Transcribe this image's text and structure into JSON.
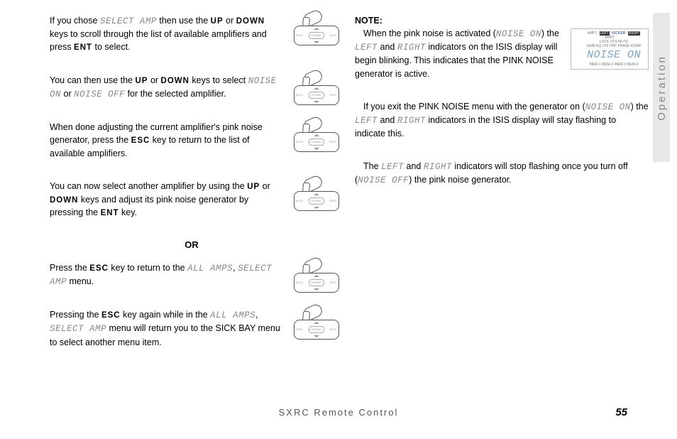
{
  "side_tab": "Operation",
  "footer": {
    "model": "SXRC Remote Control",
    "page": "55"
  },
  "keys": {
    "select_amp": "SELECT AMP",
    "up": "UP",
    "down": "DOWN",
    "ent": "ENT",
    "esc": "ESC",
    "noise_on": "NOISE ON",
    "noise_off": "NOISE OFF",
    "all_amps": "ALL AMPS",
    "left": "LEFT",
    "right": "RIGHT"
  },
  "left": {
    "p1a": "If you chose ",
    "p1b": " then use the ",
    "p1c": " or ",
    "p1d": " keys to scroll through the list of available amplifiers and press ",
    "p1e": " to select.",
    "p2a": "You can then use the ",
    "p2b": " or ",
    "p2c": " keys to select ",
    "p2d": " or ",
    "p2e": " for the selected amplifier.",
    "p3a": "When done adjusting the current amplifier's pink noise generator, press the ",
    "p3b": " key to return to the list of available amplifiers.",
    "p4a": "You can now select another amplifier by using the ",
    "p4b": " or ",
    "p4c": " keys and adjust its pink noise generator by pressing the ",
    "p4d": " key.",
    "or": "OR",
    "p5a": "Press the ",
    "p5b": " key to return to the ",
    "p5c": ", ",
    "p5d": " menu.",
    "p6a": "Pressing the ",
    "p6b": " key again while in the ",
    "p6c": ", ",
    "p6d": " menu will return you to the SICK BAY menu to select another menu item."
  },
  "right": {
    "note_title": "NOTE:",
    "p1a": "When the pink noise is activated (",
    "p1b": ") the ",
    "p1c": " and ",
    "p1d": " indicators on the ISIS display will begin blinking. This indicates that the PINK NOISE generator is active.",
    "p2a": "If you exit the PINK NOISE menu with the generator on (",
    "p2b": ") the ",
    "p2c": " and ",
    "p2d": " indicators in the ISIS display will stay flashing to indicate this.",
    "p3a": "The ",
    "p3b": " and ",
    "p3c": " indicators will stop flashing once you turn off (",
    "p3d": ") the pink noise generator."
  },
  "display": {
    "row1": [
      "AMP1",
      "LEFT",
      "KICKER",
      "RIGHT",
      "AMP2"
    ],
    "row1_hl": [
      false,
      true,
      false,
      true,
      false
    ],
    "row2": [
      "LOCK",
      "",
      "SYS",
      "",
      "MUTE"
    ],
    "row3": [
      "GAIN",
      "EQ",
      "LPF",
      "HPF",
      "PHASE",
      "KOMP"
    ],
    "big": "NOISE ON",
    "row4": [
      "MEM-1",
      "MEM-2",
      "MEM-3",
      "MEM-4"
    ]
  },
  "keypad": {
    "left": "ESC",
    "mid": "HOME",
    "right": "ENT"
  }
}
